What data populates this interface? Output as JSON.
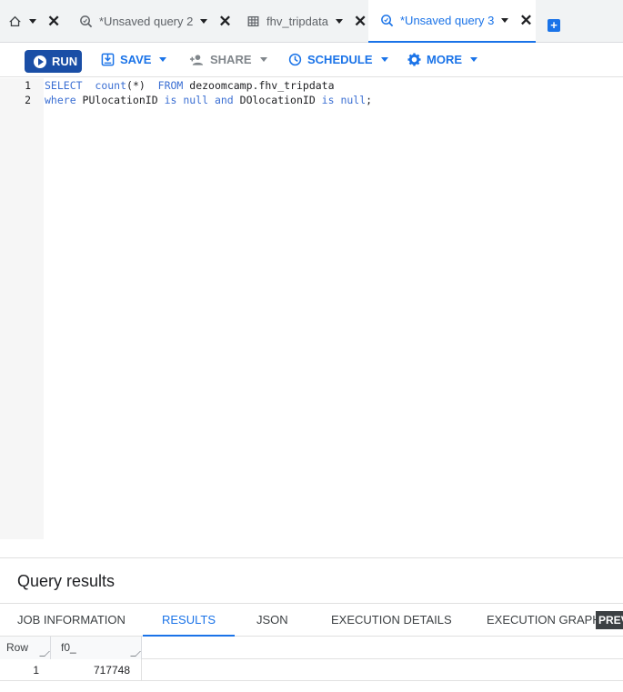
{
  "tabs": [
    {
      "label": "",
      "icon": "home-icon"
    },
    {
      "label": "*Unsaved query 2",
      "icon": "query-icon"
    },
    {
      "label": "fhv_tripdata",
      "icon": "table-icon"
    },
    {
      "label": "*Unsaved query 3",
      "icon": "query-icon",
      "active": true
    }
  ],
  "toolbar": {
    "run": "RUN",
    "save": "SAVE",
    "share": "SHARE",
    "schedule": "SCHEDULE",
    "more": "MORE"
  },
  "editor": {
    "lines": [
      {
        "num": "1",
        "text": "SELECT  count(*)  FROM dezoomcamp.fhv_tripdata"
      },
      {
        "num": "2",
        "text": "where PUlocationID is null and DOlocationID is null;"
      }
    ]
  },
  "results": {
    "title": "Query results",
    "tabs": [
      "JOB INFORMATION",
      "RESULTS",
      "JSON",
      "EXECUTION DETAILS",
      "EXECUTION GRAPH"
    ],
    "active_tab": "RESULTS",
    "preview_badge": "PREV",
    "columns": [
      "Row",
      "f0_"
    ],
    "rows": [
      {
        "row": "1",
        "f0_": "717748"
      }
    ]
  },
  "colors": {
    "accent": "#1a73e8",
    "run_button": "#1a4ea6"
  }
}
